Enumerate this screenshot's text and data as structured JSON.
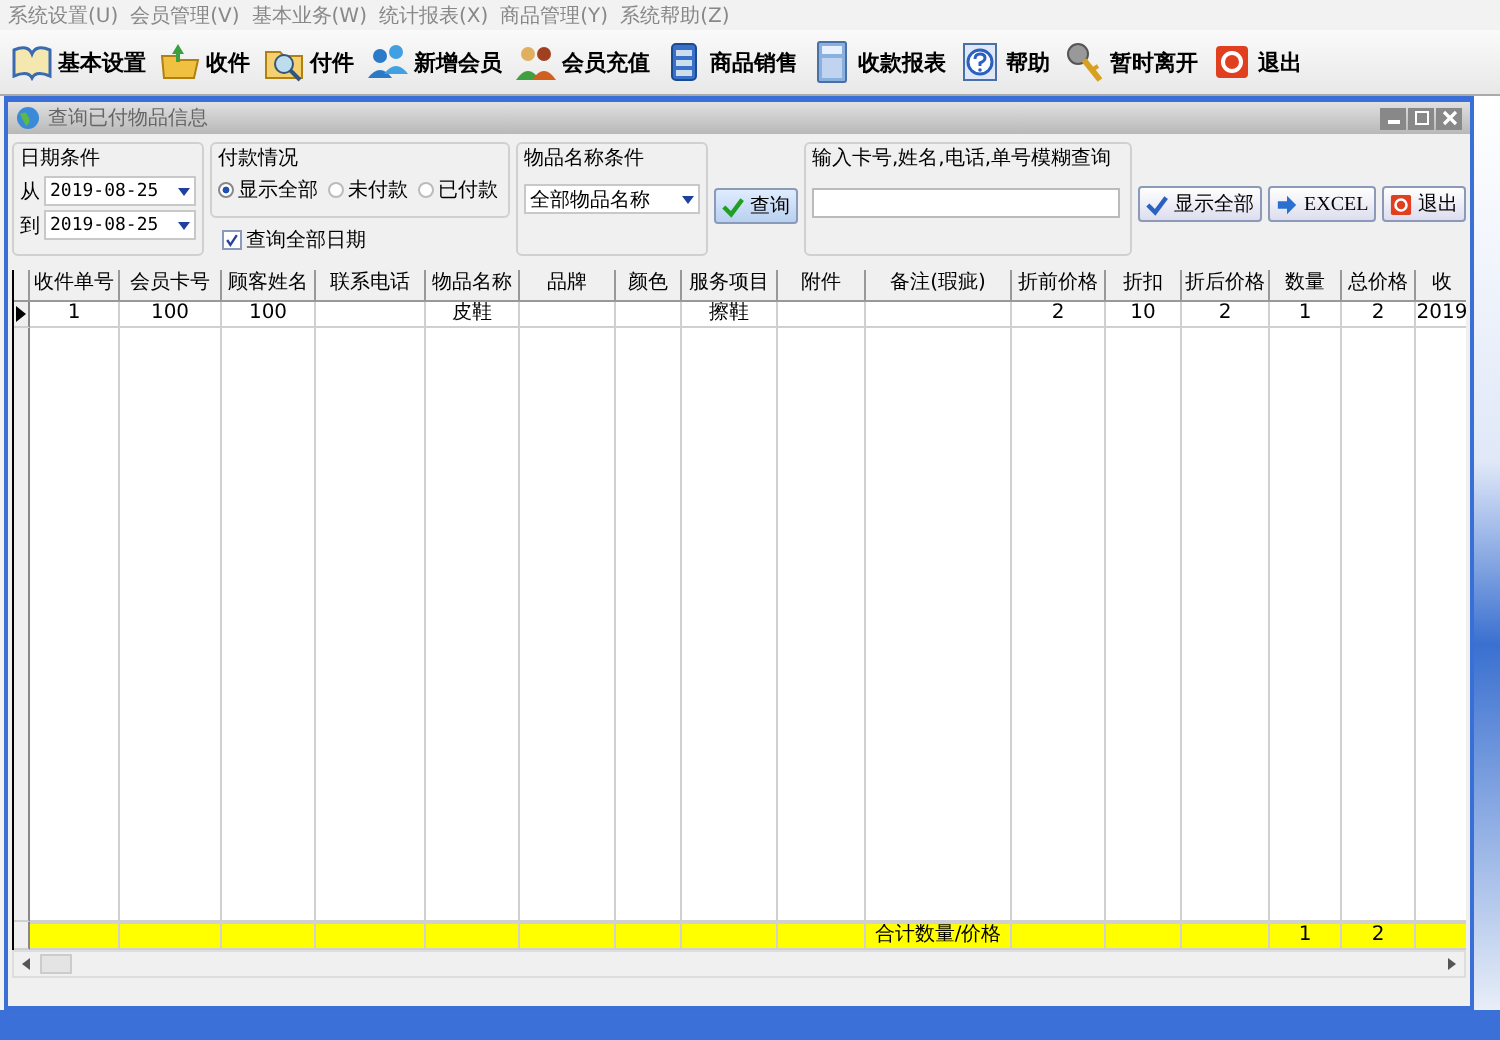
{
  "menu": [
    "系统设置(U)",
    "会员管理(V)",
    "基本业务(W)",
    "统计报表(X)",
    "商品管理(Y)",
    "系统帮助(Z)"
  ],
  "toolbar": [
    {
      "label": "基本设置"
    },
    {
      "label": "收件"
    },
    {
      "label": "付件"
    },
    {
      "label": "新增会员"
    },
    {
      "label": "会员充值"
    },
    {
      "label": "商品销售"
    },
    {
      "label": "收款报表"
    },
    {
      "label": "帮助"
    },
    {
      "label": "暂时离开"
    },
    {
      "label": "退出"
    }
  ],
  "window": {
    "title": "查询已付物品信息"
  },
  "date_filter": {
    "title": "日期条件",
    "from_label": "从",
    "from": "2019-08-25",
    "to_label": "到",
    "to": "2019-08-25"
  },
  "payment_filter": {
    "title": "付款情况",
    "options": [
      {
        "label": "显示全部",
        "selected": true
      },
      {
        "label": "未付款",
        "selected": false
      },
      {
        "label": "已付款",
        "selected": false
      }
    ]
  },
  "all_dates": {
    "label": "查询全部日期",
    "checked": true
  },
  "item_filter": {
    "title": "物品名称条件",
    "value": "全部物品名称"
  },
  "query_button": "查询",
  "search": {
    "title": "输入卡号,姓名,电话,单号模糊查询"
  },
  "buttons": [
    {
      "kind": "check",
      "label": "显示全部"
    },
    {
      "kind": "arrow",
      "label": "EXCEL"
    },
    {
      "kind": "exit",
      "label": "退出"
    }
  ],
  "table": {
    "columns": [
      "收件单号",
      "会员卡号",
      "顾客姓名",
      "联系电话",
      "物品名称",
      "品牌",
      "颜色",
      "服务项目",
      "附件",
      "备注(瑕疵)",
      "折前价格",
      "折扣",
      "折后价格",
      "数量",
      "总价格",
      "收"
    ],
    "rows": [
      {
        "current": true,
        "cells": [
          "1",
          "100",
          "100",
          null,
          "皮鞋",
          null,
          null,
          "擦鞋",
          null,
          null,
          "2",
          "10",
          "2",
          "1",
          "2",
          "2019"
        ]
      }
    ],
    "footer": {
      "label": "合计数量/价格",
      "quantity": "1",
      "total": "2"
    }
  }
}
